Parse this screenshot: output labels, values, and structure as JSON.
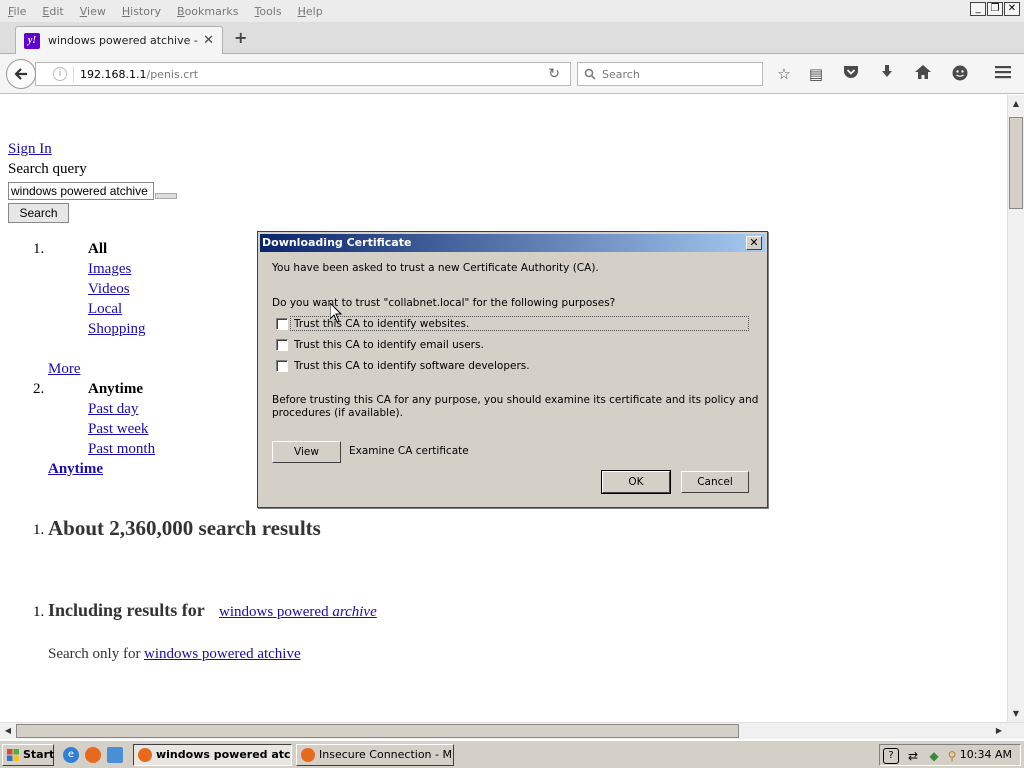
{
  "menubar": {
    "items": [
      "File",
      "Edit",
      "View",
      "History",
      "Bookmarks",
      "Tools",
      "Help"
    ],
    "window_controls": [
      "_",
      "❐",
      "✕"
    ]
  },
  "tabs": {
    "active_title": "windows powered atchive - Y...",
    "favicon_text": "y!",
    "close_glyph": "✕",
    "new_tab_glyph": "+"
  },
  "navbar": {
    "url_host": "192.168.1.1",
    "url_path": "/penis.crt",
    "search_placeholder": "Search",
    "icons": [
      "back-arrow-icon",
      "info-icon",
      "reload-icon",
      "search-icon",
      "star-icon",
      "reading-list-icon",
      "pocket-icon",
      "download-icon",
      "home-icon",
      "smiley-icon",
      "menu-icon"
    ]
  },
  "page": {
    "sign_in": "Sign In",
    "query_label": "Search query",
    "query_value": "windows powered atchive",
    "search_button": "Search",
    "filters": {
      "num1": "1.",
      "type_current": "All",
      "type_links": [
        "Images",
        "Videos",
        "Local",
        "Shopping"
      ],
      "more": "More",
      "num2": "2.",
      "time_current": "Anytime",
      "time_links": [
        "Past day",
        "Past week",
        "Past month"
      ],
      "time_selected": "Anytime"
    },
    "results": {
      "num": "1.",
      "count_text": "About 2,360,000 search results",
      "including_num": "1.",
      "including_prefix": "Including results for",
      "including_link_plain": "windows powered",
      "including_link_italic": "archive",
      "search_only_prefix": "Search only for",
      "search_only_link": "windows powered atchive"
    }
  },
  "dialog": {
    "title": "Downloading Certificate",
    "close_glyph": "✕",
    "intro": "You have been asked to trust a new Certificate Authority (CA).",
    "question": "Do you want to trust \"collabnet.local\" for the following purposes?",
    "options": [
      {
        "label": "Trust this CA to identify websites.",
        "checked": false
      },
      {
        "label": "Trust this CA to identify email users.",
        "checked": false
      },
      {
        "label": "Trust this CA to identify software developers.",
        "checked": false
      }
    ],
    "advice_line1": "Before trusting this CA for any purpose, you should examine its certificate and its policy and",
    "advice_line2": "procedures (if available).",
    "view_button": "View",
    "view_caption": "Examine CA certificate",
    "ok_button": "OK",
    "cancel_button": "Cancel"
  },
  "taskbar": {
    "start_label": "Start",
    "tasks": [
      {
        "label": "windows powered atc...",
        "active": true
      },
      {
        "label": "Insecure Connection - M...",
        "active": false
      }
    ],
    "clock": "10:34 AM"
  },
  "colors": {
    "link": "#1a0dab",
    "dialog_bg": "#d4d0c8",
    "titlebar_start": "#0a246a",
    "titlebar_end": "#a6caf0",
    "yahoo_purple": "#6001d2"
  }
}
